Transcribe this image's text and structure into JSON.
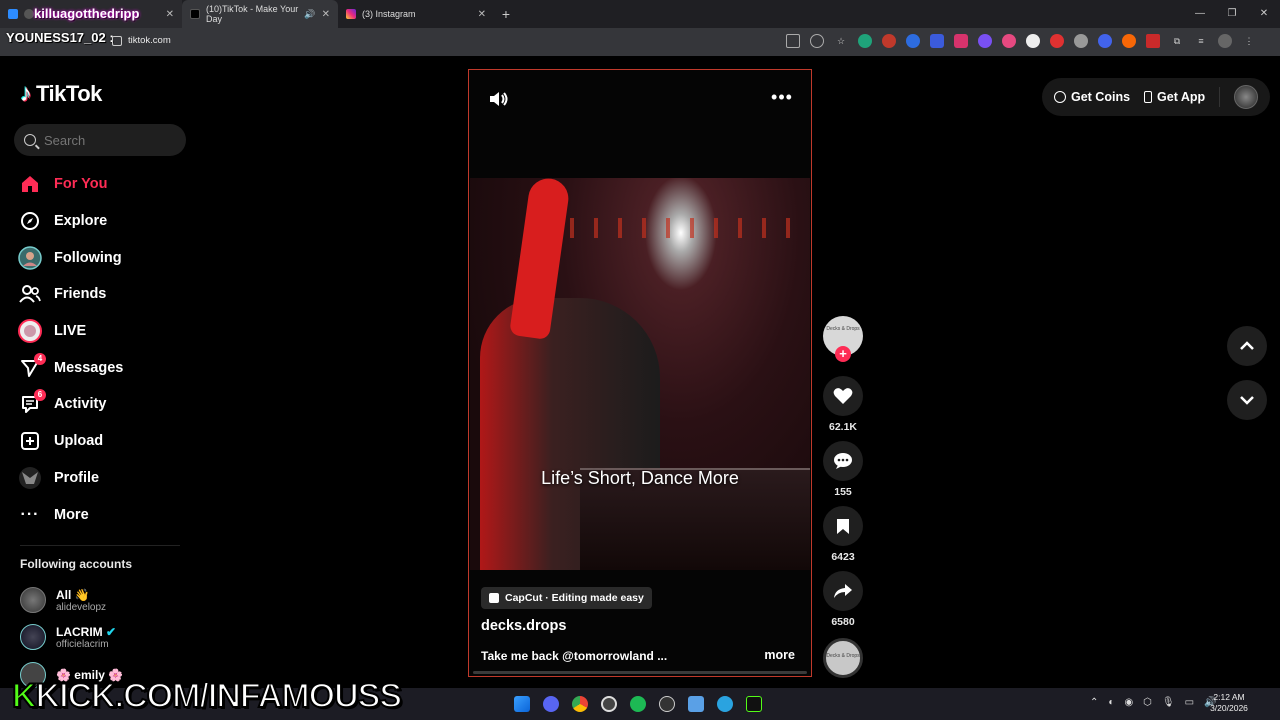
{
  "browser": {
    "tabs": [
      {
        "label": "killuagotthedripp",
        "active": false
      },
      {
        "label": "(10)TikTok - Make Your Day",
        "active": true
      },
      {
        "label": "(3) Instagram",
        "active": false
      }
    ],
    "new_tab": "+",
    "address": "tiktok.com",
    "overlay_name": "YOUNESS17_02 :"
  },
  "tiktok": {
    "logo": "TikTok",
    "search_placeholder": "Search",
    "nav": [
      {
        "label": "For You",
        "icon": "home-icon",
        "active": true
      },
      {
        "label": "Explore",
        "icon": "compass-icon"
      },
      {
        "label": "Following",
        "icon": "following-avatar-icon"
      },
      {
        "label": "Friends",
        "icon": "friends-icon"
      },
      {
        "label": "LIVE",
        "icon": "live-icon"
      },
      {
        "label": "Messages",
        "icon": "messages-icon",
        "badge": "4"
      },
      {
        "label": "Activity",
        "icon": "activity-icon",
        "badge": "6"
      },
      {
        "label": "Upload",
        "icon": "upload-icon"
      },
      {
        "label": "Profile",
        "icon": "profile-icon"
      },
      {
        "label": "More",
        "icon": "more-dots-icon"
      }
    ],
    "following_header": "Following accounts",
    "accounts": [
      {
        "name": "All 👋",
        "handle": "alidevelopz"
      },
      {
        "name": "LACRIM",
        "handle": "officielacrim",
        "verified": true
      },
      {
        "name": "🌸 emily 🌸",
        "handle": ""
      }
    ]
  },
  "video": {
    "caption": "Life’s Short, Dance More",
    "capcut": "CapCut · Editing made easy",
    "author": "decks.drops",
    "description": "Take me back @tomorrowland ...",
    "more": "more",
    "creator_avatar_text": "Decks & Drops"
  },
  "actions": {
    "likes": "62.1K",
    "comments": "155",
    "saves": "6423",
    "shares": "6580"
  },
  "topright": {
    "coins": "Get Coins",
    "app": "Get App"
  },
  "overlay": {
    "kick_k": "K",
    "kick_text": "KICK.COM/INFAMOUSS"
  },
  "system": {
    "time": "2:12 AM",
    "date": "3/20/2026"
  },
  "colors": {
    "accent": "#fe2c55",
    "video_border": "#c0392b",
    "kick_green": "#53fc18"
  }
}
